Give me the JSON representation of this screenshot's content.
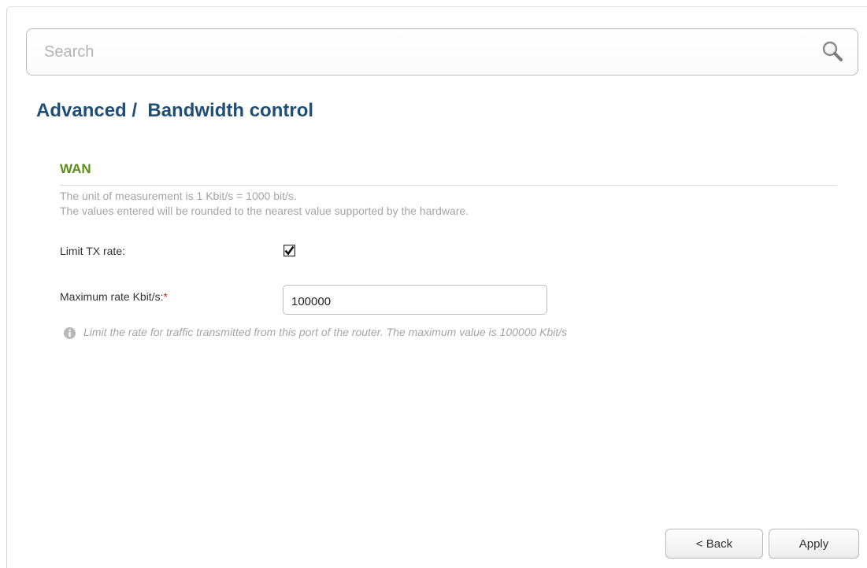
{
  "search": {
    "placeholder": "Search"
  },
  "page": {
    "breadcrumb": "Advanced /  Bandwidth control"
  },
  "wan": {
    "section_title": "WAN",
    "note_line1": "The unit of measurement is 1 Kbit/s = 1000 bit/s.",
    "note_line2": "The values entered will be rounded to the nearest value supported by the hardware.",
    "limit_tx_label": "Limit TX rate:",
    "limit_tx_checked": true,
    "max_rate_label": "Maximum rate Kbit/s:",
    "required_marker": "*",
    "max_rate_value": "100000",
    "hint": "Limit the rate for traffic transmitted from this port of the router. The maximum value is 100000 Kbit/s"
  },
  "buttons": {
    "back": "< Back",
    "apply": "Apply"
  },
  "colors": {
    "title": "#1f4e79",
    "section": "#5c8d1a",
    "required": "#cc2222"
  },
  "icons": {
    "search": "magnifier",
    "hint": "info-circle",
    "checkbox": "checkmark"
  }
}
